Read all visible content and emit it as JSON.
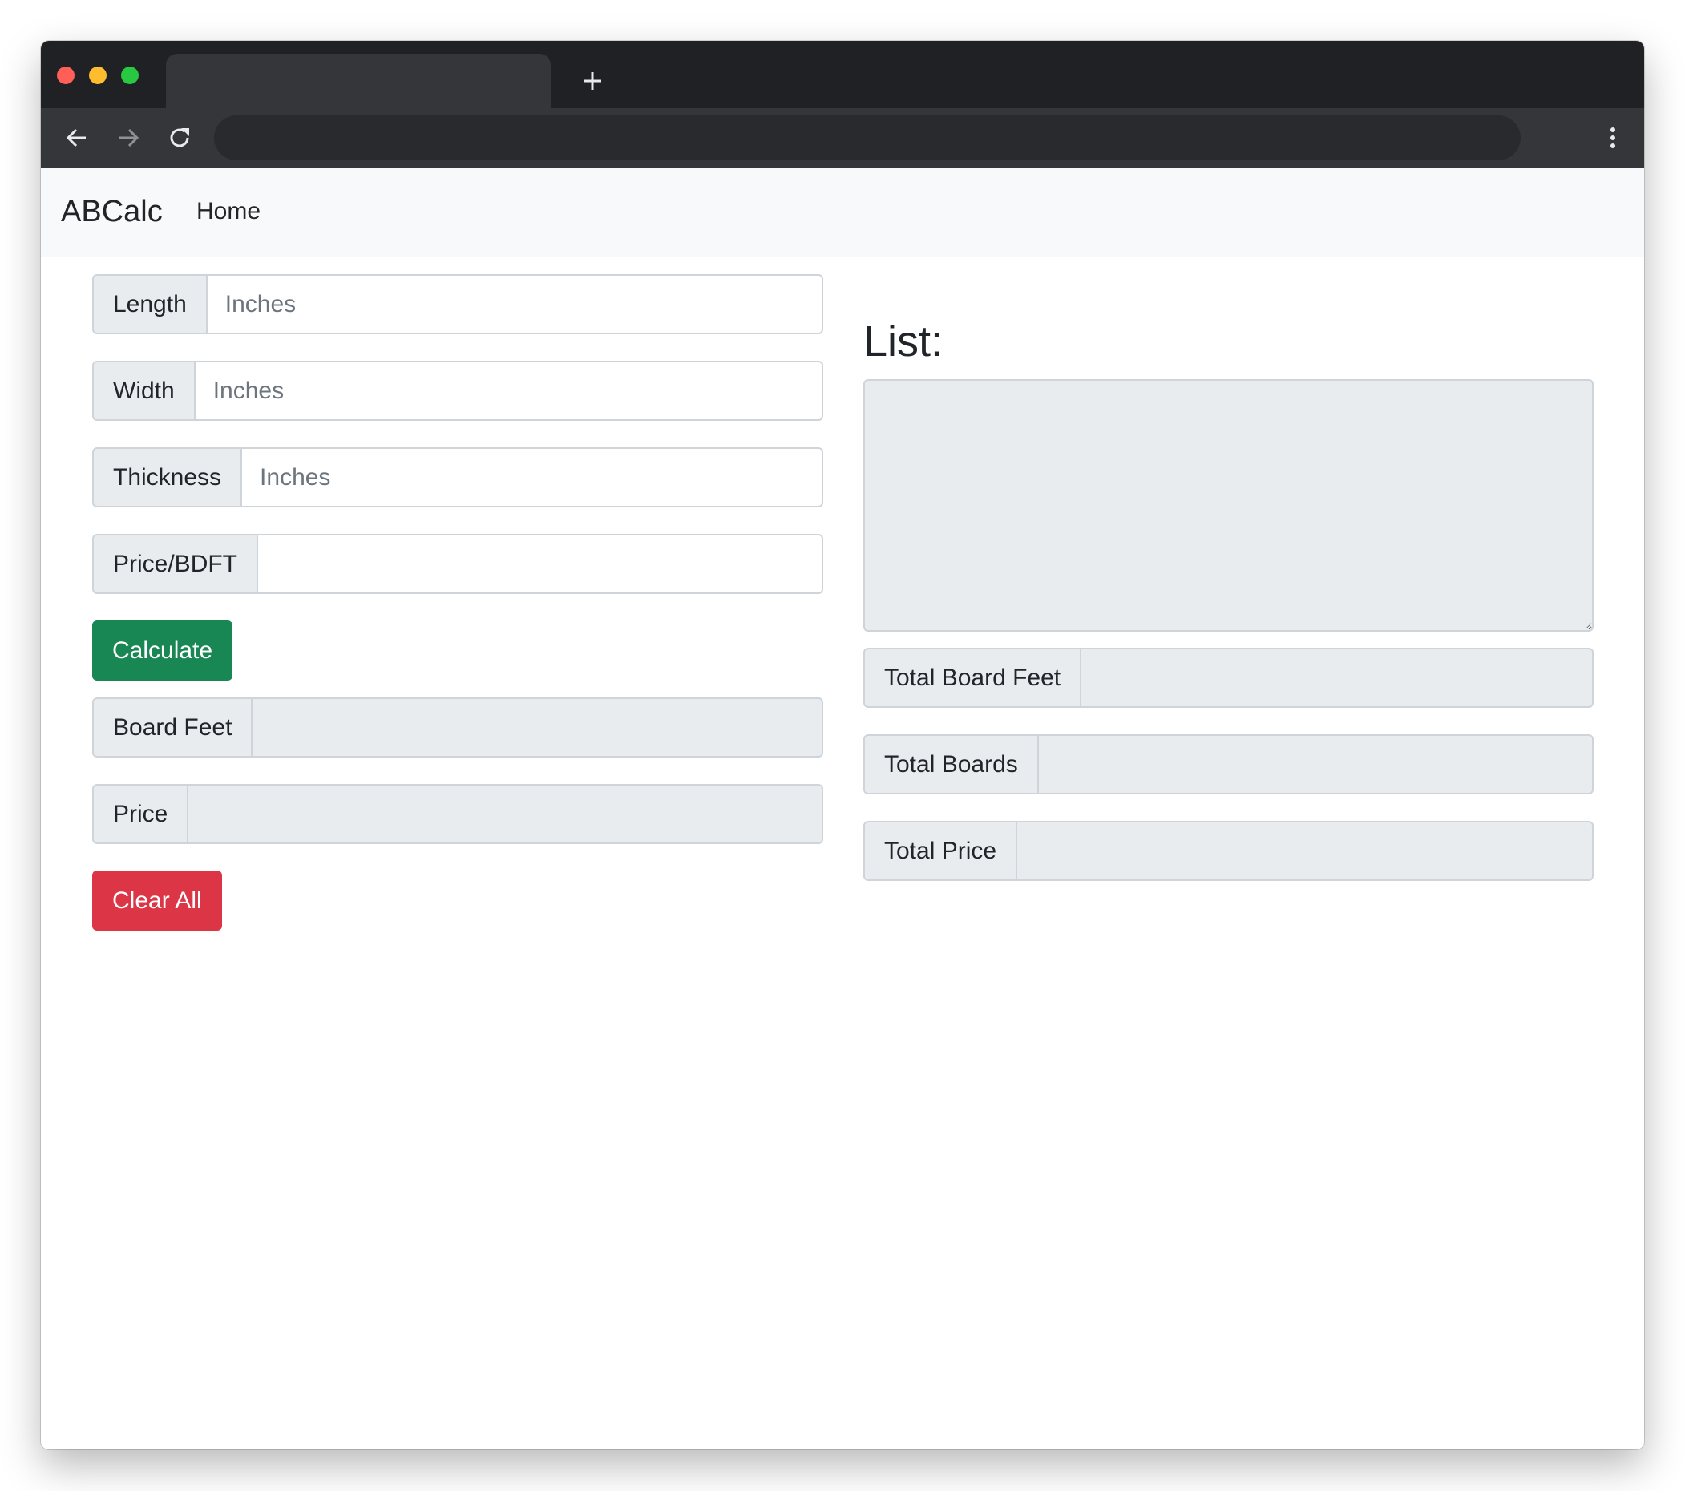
{
  "browser": {
    "traffic_colors": [
      "#ff5f57",
      "#febc2e",
      "#28c840"
    ],
    "tab_title": "",
    "address": ""
  },
  "navbar": {
    "brand": "ABCalc",
    "links": [
      "Home"
    ]
  },
  "form": {
    "length": {
      "label": "Length",
      "placeholder": "Inches"
    },
    "width": {
      "label": "Width",
      "placeholder": "Inches"
    },
    "thickness": {
      "label": "Thickness",
      "placeholder": "Inches"
    },
    "price_per_bdft": {
      "label": "Price/BDFT",
      "placeholder": ""
    },
    "calculate_button": "Calculate",
    "board_feet": {
      "label": "Board Feet",
      "value": ""
    },
    "price": {
      "label": "Price",
      "value": ""
    },
    "clear_button": "Clear All"
  },
  "list_panel": {
    "heading": "List:",
    "list_value": "",
    "total_board_feet": {
      "label": "Total Board Feet",
      "value": ""
    },
    "total_boards": {
      "label": "Total Boards",
      "value": ""
    },
    "total_price": {
      "label": "Total Price",
      "value": ""
    }
  },
  "colors": {
    "success": "#198754",
    "danger": "#dc3545",
    "navbar_bg": "#f8f9fa",
    "addon_bg": "#e9ecef"
  },
  "icons": {
    "back": "arrow-left-icon",
    "forward": "arrow-right-icon",
    "reload": "reload-icon",
    "new_tab": "plus-icon",
    "menu": "kebab-menu-icon"
  }
}
